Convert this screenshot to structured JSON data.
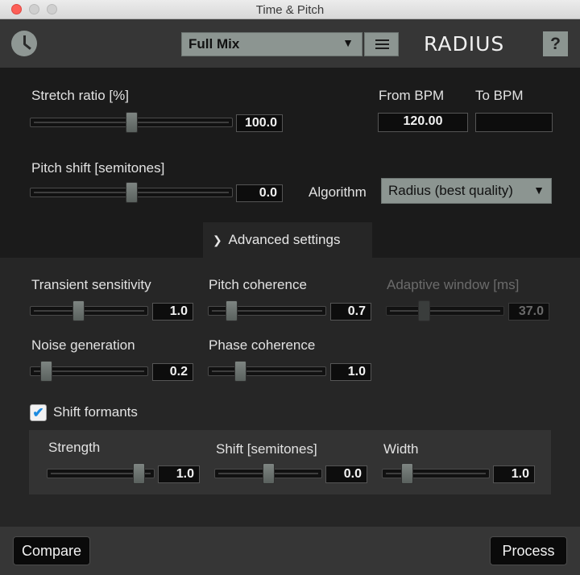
{
  "window": {
    "title": "Time & Pitch"
  },
  "toolbar": {
    "mix_select": "Full Mix",
    "logo": "RADIUS",
    "help": "?"
  },
  "stretch": {
    "label": "Stretch ratio [%]",
    "value": "100.0",
    "position": 0.5
  },
  "bpm": {
    "from_label": "From BPM",
    "from_value": "120.00",
    "to_label": "To BPM",
    "to_value": ""
  },
  "pitch": {
    "label": "Pitch shift [semitones]",
    "value": "0.0",
    "position": 0.5
  },
  "algorithm": {
    "label": "Algorithm",
    "value": "Radius (best quality)"
  },
  "advanced": {
    "toggle_label": "Advanced settings",
    "transient": {
      "label": "Transient sensitivity",
      "value": "1.0",
      "position": 0.4
    },
    "pitch_coherence": {
      "label": "Pitch coherence",
      "value": "0.7",
      "position": 0.17
    },
    "adaptive_window": {
      "label": "Adaptive window [ms]",
      "value": "37.0",
      "position": 0.3,
      "disabled": true
    },
    "noise": {
      "label": "Noise generation",
      "value": "0.2",
      "position": 0.1
    },
    "phase_coherence": {
      "label": "Phase coherence",
      "value": "1.0",
      "position": 0.25
    }
  },
  "formants": {
    "checkbox_label": "Shift formants",
    "checked": true,
    "strength": {
      "label": "Strength",
      "value": "1.0",
      "position": 0.9
    },
    "shift": {
      "label": "Shift [semitones]",
      "value": "0.0",
      "position": 0.5
    },
    "width": {
      "label": "Width",
      "value": "1.0",
      "position": 0.2
    }
  },
  "buttons": {
    "compare": "Compare",
    "process": "Process"
  },
  "colors": {
    "control_gray": "#8c9591",
    "checkbox_check": "#1b8be0"
  }
}
